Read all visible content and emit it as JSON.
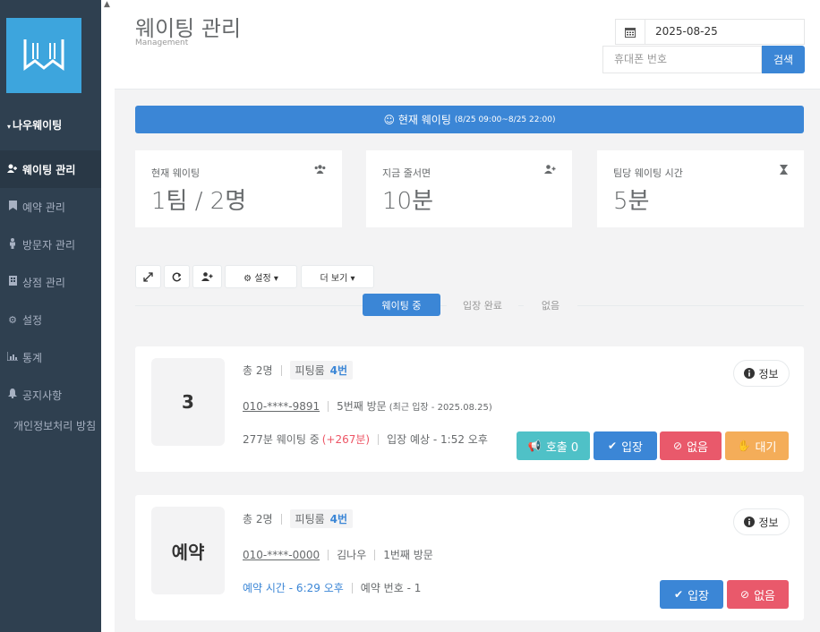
{
  "sidebar": {
    "brand": "나우웨이팅",
    "items": [
      {
        "label": "웨이팅 관리",
        "icon": "user-plus-icon",
        "glyph": "👤"
      },
      {
        "label": "예약 관리",
        "icon": "bookmark-icon",
        "glyph": "▮"
      },
      {
        "label": "방문자 관리",
        "icon": "person-icon",
        "glyph": "♟"
      },
      {
        "label": "상점 관리",
        "icon": "building-icon",
        "glyph": "▤"
      },
      {
        "label": "설정",
        "icon": "gear-icon",
        "glyph": "⚙"
      },
      {
        "label": "통계",
        "icon": "bar-chart-icon",
        "glyph": "▥"
      },
      {
        "label": "공지사항",
        "icon": "bell-icon",
        "glyph": "🔔"
      },
      {
        "label": "개인정보처리 방침",
        "icon": "",
        "glyph": ""
      }
    ]
  },
  "header": {
    "title": "웨이팅 관리",
    "subtitle": "Management",
    "date": "2025-08-25",
    "search_placeholder": "휴대폰 번호",
    "search_button": "검색"
  },
  "banner": {
    "title": "☺ 현재 웨이팅",
    "range": "(8/25 09:00~8/25 22:00)"
  },
  "stats": [
    {
      "label": "현재 웨이팅",
      "value": "1팀 / 2명",
      "icon": "users-icon"
    },
    {
      "label": "지금 줄서면",
      "value": "10분",
      "icon": "user-plus-icon"
    },
    {
      "label": "팀당 웨이팅 시간",
      "value": "5분",
      "icon": "hourglass-icon"
    }
  ],
  "toolbar": {
    "settings_label": "⚙ 설정 ▾",
    "more_label": "더 보기 ▾"
  },
  "tabs": [
    "웨이팅 중",
    "입장 완료",
    "없음"
  ],
  "cards": [
    {
      "number": "3",
      "total": "총 2명",
      "room_label": "피팅룸",
      "room_no": "4번",
      "phone": "010-****-9891",
      "visit": "5번째 방문",
      "recent": "(최근 입장 - 2025.08.25)",
      "waiting": "277분 웨이팅 중",
      "waiting_over": "(+267분)",
      "expected": "입장 예상 - 1:52 오후",
      "info": "정보",
      "buttons": [
        "호출 0",
        "입장",
        "없음",
        "대기"
      ]
    },
    {
      "number": "예약",
      "total": "총 2명",
      "room_label": "피팅룸",
      "room_no": "4번",
      "phone": "010-****-0000",
      "name": "김나우",
      "visit": "1번째 방문",
      "reserve_time": "예약 시간 - 6:29 오후",
      "reserve_no": "예약 번호 - 1",
      "info": "정보",
      "buttons": [
        "입장",
        "없음"
      ]
    }
  ],
  "colors": {
    "sidebar": "#2f4050",
    "primary": "#3b86d6",
    "teal": "#4fc1c7",
    "danger": "#e9596b",
    "warning": "#f4ad59"
  }
}
